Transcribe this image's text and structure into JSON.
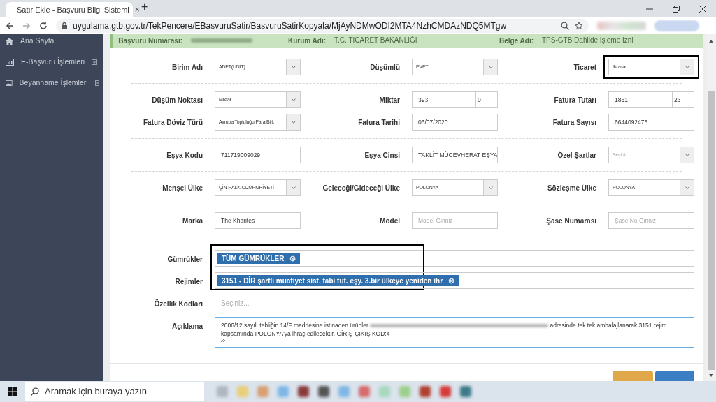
{
  "browser": {
    "tab_title": "Satır Ekle - Başvuru Bilgi Sistemi",
    "tab_close": "×",
    "new_tab": "+",
    "url": "uygulama.gtb.gov.tr/TekPencere/EBasvuruSatir/BasvuruSatirKopyala/MjAyNDMwODI2MTA4NzhCMDAzNDQ5MTgw"
  },
  "sidebar": {
    "items": [
      {
        "label": "Ana Sayfa",
        "expandable": false
      },
      {
        "label": "E-Başvuru İşlemleri",
        "expandable": true
      },
      {
        "label": "Beyanname İşlemleri",
        "expandable": true
      }
    ]
  },
  "info_bar": [
    {
      "label": "Başvuru Numarası:"
    },
    {
      "label": "Kurum Adı:",
      "value": "T.C. TİCARET BAKANLIĞI"
    },
    {
      "label": "Belge Adı:",
      "value": "TPS-GTB Dahilde İşleme İzni"
    }
  ],
  "form_rows": [
    {
      "divider_after": true,
      "fields": [
        {
          "label": "Birim Adı",
          "kind": "select",
          "value": "ADET(UNIT)",
          "highlighted": false
        },
        {
          "label": "Düşümlü",
          "kind": "select",
          "value": "EVET",
          "highlighted": false
        },
        {
          "label": "Ticaret",
          "kind": "select",
          "value": "İhracat",
          "highlighted": true
        }
      ]
    },
    {
      "divider_after": false,
      "fields": [
        {
          "label": "Düşüm Noktası",
          "kind": "select",
          "value": "Miktar",
          "highlighted": false
        },
        {
          "label": "Miktar",
          "kind": "split",
          "value": "393",
          "value2": "0",
          "highlighted": false
        },
        {
          "label": "Fatura Tutarı",
          "kind": "split",
          "value": "1861",
          "value2": "23",
          "highlighted": false
        }
      ]
    },
    {
      "divider_after": true,
      "fields": [
        {
          "label": "Fatura Döviz Türü",
          "kind": "select",
          "value": "Avrupa Topluluğu Para Biri.",
          "highlighted": false
        },
        {
          "label": "Fatura Tarihi",
          "kind": "input",
          "value": "06/07/2020",
          "highlighted": false
        },
        {
          "label": "Fatura Sayısı",
          "kind": "input",
          "value": "6644092475",
          "highlighted": false
        }
      ]
    },
    {
      "divider_after": true,
      "fields": [
        {
          "label": "Eşya Kodu",
          "kind": "input",
          "value": "711719009029",
          "highlighted": false
        },
        {
          "label": "Eşya Cinsi",
          "kind": "input",
          "value": "TAKLİT MÜCEVHERAT EŞYA",
          "highlighted": false
        },
        {
          "label": "Özel Şartlar",
          "kind": "select",
          "placeholder": "Seçiniz...",
          "highlighted": false
        }
      ]
    },
    {
      "divider_after": true,
      "fields": [
        {
          "label": "Menşei Ülke",
          "kind": "select",
          "value": "ÇİN HALK CUMHURİYETİ",
          "highlighted": false
        },
        {
          "label": "Geleceği/Gideceği Ülke",
          "kind": "select",
          "value": "POLONYA",
          "highlighted": false
        },
        {
          "label": "Sözleşme Ülke",
          "kind": "select",
          "value": "POLONYA",
          "highlighted": false
        }
      ]
    },
    {
      "divider_after": true,
      "fields": [
        {
          "label": "Marka",
          "kind": "input",
          "value": "The Kharites",
          "highlighted": false
        },
        {
          "label": "Model",
          "kind": "input",
          "placeholder": "Model Giriniz",
          "highlighted": false
        },
        {
          "label": "Şase Numarası",
          "kind": "input",
          "placeholder": "Şase No Giriniz",
          "highlighted": false
        }
      ]
    }
  ],
  "wide_rows": [
    {
      "label": "Gümrükler",
      "kind": "tags",
      "tags": [
        "TÜM GÜMRÜKLER"
      ],
      "tag_remove": "⊗"
    },
    {
      "label": "Rejimler",
      "kind": "tags",
      "tags": [
        "3151 - DİR şartlı muafiyet sist. tabi tut. eşy. 3.bir ülkeye yeniden ihr"
      ],
      "tag_remove": "⊗"
    },
    {
      "label": "Özellik Kodları",
      "kind": "select",
      "placeholder": "Seçiniz..."
    },
    {
      "label": "Açıklama",
      "kind": "textarea",
      "text_before": "2006/12 sayılı tebliğin 14/F  maddesine istinaden ürünler",
      "text_after": "adresinde  tek tek ambalajlanarak  3151 rejim kapsamında  POLONYA'ya ihraç edilecektir. GİRİŞ-ÇIKIŞ KOD:4"
    }
  ],
  "taskbar": {
    "search_placeholder": "Aramak için buraya yazın"
  }
}
